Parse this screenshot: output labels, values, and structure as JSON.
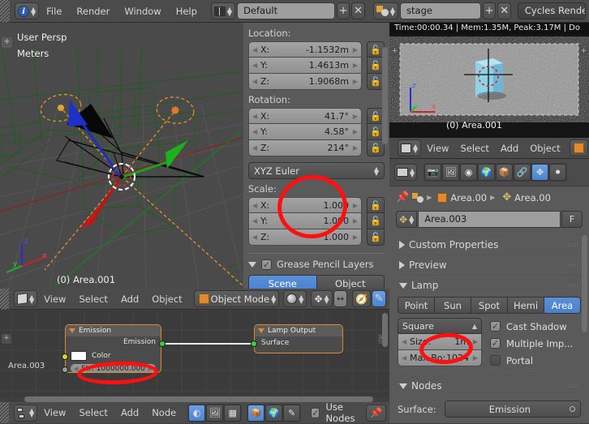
{
  "topbar": {
    "editor_icon": "info-editor-icon",
    "menus": [
      "File",
      "Render",
      "Window",
      "Help"
    ],
    "layout_icon": "screen-layout-icon",
    "screen_name": "Default",
    "add_label": "+",
    "delete_label": "✕",
    "scene_icon": "scene-icon",
    "scene_name": "stage",
    "scene_add_label": "+",
    "scene_delete_label": "✕",
    "render_engine": "Cycles Render"
  },
  "viewport3d": {
    "view_name": "User Persp",
    "units": "Meters",
    "object_label": "(0) Area.001",
    "axis_labels": {
      "x": "x",
      "y": "y",
      "z": "z"
    }
  },
  "properties_n_panel": {
    "location_label": "Location:",
    "location": [
      {
        "axis": "X:",
        "value": "-1.1532m"
      },
      {
        "axis": "Y:",
        "value": "1.4613m"
      },
      {
        "axis": "Z:",
        "value": "1.9068m"
      }
    ],
    "rotation_label": "Rotation:",
    "rotation": [
      {
        "axis": "X:",
        "value": "41.7°"
      },
      {
        "axis": "Y:",
        "value": "4.58°"
      },
      {
        "axis": "Z:",
        "value": "214°"
      }
    ],
    "rotation_mode": "XYZ Euler",
    "scale_label": "Scale:",
    "scale": [
      {
        "axis": "X:",
        "value": "1.000"
      },
      {
        "axis": "Y:",
        "value": "1.000"
      },
      {
        "axis": "Z:",
        "value": "1.000"
      }
    ],
    "grease_pencil_label": "Grease Pencil Layers",
    "gp_tabs": [
      "Scene",
      "Object"
    ],
    "gp_tab_active": "Scene"
  },
  "render_result": {
    "stats": "Time:00:00.34 | Mem:1.35M, Peak:3.17M | Do",
    "object_label": "(0) Area.001",
    "axis_labels": {
      "x": "x",
      "y": "y",
      "z": "z"
    }
  },
  "image_editor_header": {
    "editor_icon": "uv-image-editor-icon",
    "menus": [
      "View",
      "Select",
      "Add",
      "Object"
    ],
    "mode_icon": "object-mode-icon"
  },
  "properties_editor": {
    "editor_icon": "properties-editor-icon",
    "tab_icons": [
      "render-tab-icon",
      "render-layers-tab-icon",
      "scene-tab-icon",
      "world-tab-icon",
      "object-tab-icon",
      "constraints-tab-icon",
      "data-lamp-tab-icon",
      "material-tab-icon"
    ],
    "active_tab": "data-lamp-tab-icon",
    "breadcrumb": {
      "pin_icon": "pin-icon",
      "scene_icon": "scene-icon",
      "object_icon": "object-icon",
      "object_name": "Area.00",
      "data_icon": "lamp-data-icon",
      "data_name": "Area.00"
    },
    "datablock": {
      "icon": "lamp-data-icon",
      "name": "Area.003",
      "fake_user": "F"
    },
    "collapsed_panels": [
      "Custom Properties",
      "Preview"
    ],
    "lamp_panel": {
      "title": "Lamp",
      "types": [
        "Point",
        "Sun",
        "Spot",
        "Hemi",
        "Area"
      ],
      "active_type": "Area",
      "shape": "Square",
      "size_label": "Size:",
      "size_value": "1m",
      "maxbo_label": "Max Bo:",
      "maxbo_value": "1024",
      "checkboxes": [
        {
          "label": "Cast Shadow",
          "checked": true
        },
        {
          "label": "Multiple Imp...",
          "checked": true
        },
        {
          "label": "Portal",
          "checked": false
        }
      ]
    },
    "nodes_panel": {
      "title": "Nodes",
      "surface_label": "Surface:",
      "surface_value": "Emission"
    }
  },
  "node_editor": {
    "header": {
      "editor_icon": "node-editor-icon",
      "menus": [
        "View",
        "Select",
        "Add",
        "Node"
      ],
      "shader_type_icons": [
        "material-shader-icon",
        "texture-shader-icon",
        "compositing-icon"
      ],
      "context_icons": [
        "object-context-icon",
        "world-context-icon",
        "brush-context-icon"
      ],
      "use_nodes_label": "Use Nodes",
      "use_nodes_checked": true,
      "pin_icon": "pin-icon"
    },
    "breadcrumb_label": "Area.003",
    "nodes": [
      {
        "title": "Emission",
        "output_label": "Emission",
        "color_label": "Color",
        "color_value": "#ffffff",
        "strength_label": "Str: 1000000.000"
      },
      {
        "title": "Lamp Output",
        "input_label": "Surface"
      }
    ]
  },
  "tool_header": {
    "editor_icon": "view3d-editor-icon",
    "menus": [
      "View",
      "Select",
      "Add",
      "Object"
    ],
    "mode_icon": "object-mode-icon",
    "mode_label": "Object Mode",
    "shading_icon": "shading-icon",
    "pivot_icon": "pivot-icon",
    "snap_icon": "snap-icon",
    "manipulator_icon": "manipulator-icon"
  },
  "annotations": {
    "accent_color": "#ff1010",
    "marks": [
      "scale-highlight",
      "strength-highlight",
      "size-highlight"
    ]
  }
}
